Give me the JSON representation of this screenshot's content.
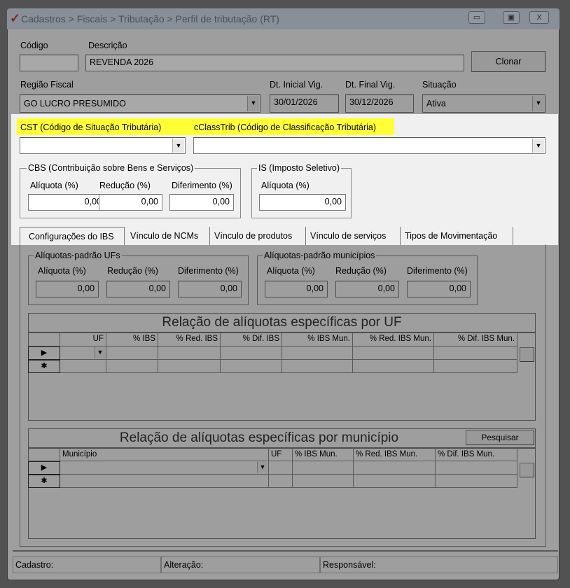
{
  "window": {
    "title": "Cadastros > Fiscais > Tributação > Perfil de tributação (RT)",
    "minimize": "▭",
    "maximize": "▣",
    "close": "X"
  },
  "header": {
    "codigo_label": "Código",
    "codigo_value": "",
    "descricao_label": "Descrição",
    "descricao_value": "REVENDA 2026",
    "clonar": "Clonar",
    "regiao_label": "Região Fiscal",
    "regiao_value": "GO LUCRO PRESUMIDO",
    "dt_inicial_label": "Dt. Inicial Vig.",
    "dt_inicial_value": "30/01/2026",
    "dt_final_label": "Dt. Final Vig.",
    "dt_final_value": "30/12/2026",
    "situacao_label": "Situação",
    "situacao_value": "Ativa"
  },
  "cst": {
    "label": "CST (Código de Situação Tributária)",
    "value": ""
  },
  "cclass": {
    "label": "cClassTrib (Código de Classificação Tributária)",
    "value": ""
  },
  "cbs": {
    "title": "CBS (Contribuição sobre Bens e Serviços)",
    "aliquota_label": "Alíquota (%)",
    "aliquota": "0,00",
    "reducao_label": "Redução (%)",
    "reducao": "0,00",
    "diferimento_label": "Diferimento (%)",
    "diferimento": "0,00"
  },
  "is": {
    "title": "IS (Imposto Seletivo)",
    "aliquota_label": "Alíquota (%)",
    "aliquota": "0,00"
  },
  "tabs": [
    "Configurações do IBS",
    "Vínculo de NCMs",
    "Vínculo de produtos",
    "Vínculo de serviços",
    "Tipos de Movimentação"
  ],
  "ibs": {
    "ufs": {
      "title": "Alíquotas-padrão UFs",
      "labels": [
        "Alíquota (%)",
        "Redução (%)",
        "Diferimento (%)"
      ],
      "values": [
        "0,00",
        "0,00",
        "0,00"
      ]
    },
    "mun": {
      "title": "Alíquotas-padrão municípios",
      "labels": [
        "Alíquota (%)",
        "Redução (%)",
        "Diferimento (%)"
      ],
      "values": [
        "0,00",
        "0,00",
        "0,00"
      ]
    },
    "grid_uf": {
      "title": "Relação de alíquotas específicas por UF",
      "columns": [
        "UF",
        "% IBS",
        "% Red. IBS",
        "% Dif. IBS",
        "% IBS Mun.",
        "% Red. IBS Mun.",
        "% Dif. IBS Mun."
      ]
    },
    "grid_mun": {
      "title": "Relação de alíquotas específicas por município",
      "search": "Pesquisar",
      "columns": [
        "Município",
        "UF",
        "% IBS Mun.",
        "% Red. IBS Mun.",
        "% Dif. IBS Mun."
      ]
    },
    "row_current": "▶",
    "row_new": "✱"
  },
  "status": {
    "cadastro": "Cadastro:",
    "alteracao": "Alteração:",
    "responsavel": "Responsável:"
  }
}
